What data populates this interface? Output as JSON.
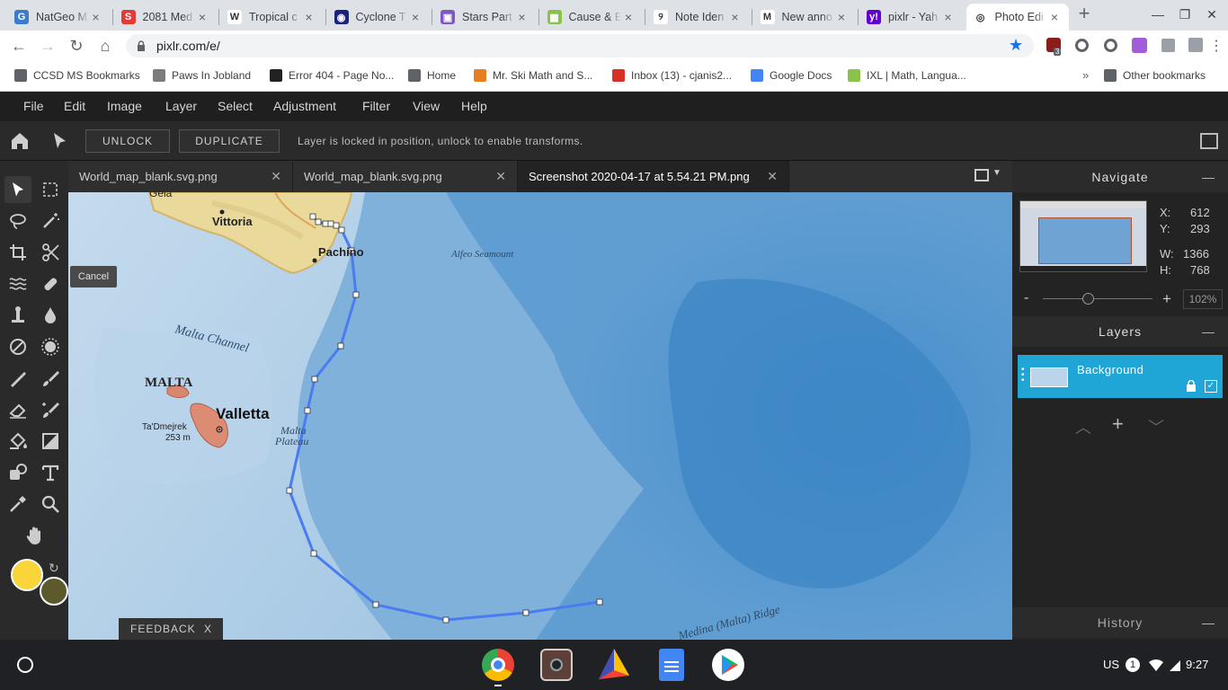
{
  "browser": {
    "tabs": [
      {
        "label": "NatGeo M",
        "color": "#3d7cc9",
        "glyph": "G"
      },
      {
        "label": "2081 Med",
        "color": "#e53935",
        "glyph": "S"
      },
      {
        "label": "Tropical c",
        "color": "#ffffff",
        "glyph": "W"
      },
      {
        "label": "Cyclone T",
        "color": "#1a237e",
        "glyph": "◉"
      },
      {
        "label": "Stars Part",
        "color": "#7e57c2",
        "glyph": "▣"
      },
      {
        "label": "Cause & E",
        "color": "#8bc34a",
        "glyph": "▦"
      },
      {
        "label": "Note Iden",
        "color": "#ffffff",
        "glyph": "୨"
      },
      {
        "label": "New anno",
        "color": "#ffffff",
        "glyph": "M"
      },
      {
        "label": "pixlr - Yah",
        "color": "#6001d2",
        "glyph": "y!"
      },
      {
        "label": "Photo Edi",
        "color": "#ffffff",
        "glyph": "◎"
      }
    ],
    "url": "pixlr.com/e/",
    "bookmarks": [
      "CCSD MS Bookmarks",
      "Paws In Jobland",
      "Error 404 - Page No...",
      "Home",
      "Mr. Ski Math and S...",
      "Inbox (13) - cjanis2...",
      "Google Docs",
      "IXL | Math, Langua..."
    ],
    "other_bookmarks": "Other bookmarks",
    "extension_badge": "3",
    "bookmark_more": "»"
  },
  "pixlr": {
    "menu": [
      "File",
      "Edit",
      "Image",
      "Layer",
      "Select",
      "Adjustment",
      "Filter",
      "View",
      "Help"
    ],
    "unlock_label": "UNLOCK",
    "duplicate_label": "DUPLICATE",
    "hint": "Layer is locked in position, unlock to enable transforms.",
    "doc_tabs": [
      "World_map_blank.svg.png",
      "World_map_blank.svg.png",
      "Screenshot 2020-04-17 at 5.54.21 PM.png"
    ],
    "cancel_label": "Cancel",
    "feedback_label": "FEEDBACK",
    "feedback_close": "X",
    "navigate": {
      "title": "Navigate",
      "x_label": "X:",
      "x": "612",
      "y_label": "Y:",
      "y": "293",
      "w_label": "W:",
      "w": "1366",
      "h_label": "H:",
      "h": "768",
      "zoom": "102%",
      "minus": "-",
      "plus": "+"
    },
    "layers": {
      "title": "Layers",
      "items": [
        "Background"
      ]
    },
    "history_title": "History",
    "colors": {
      "primary": "#f9d53a",
      "secondary": "#5c5a2a"
    }
  },
  "map_labels": {
    "gela": "Gela",
    "vittoria": "Vittoria",
    "pachino": "Pachino",
    "alfeo": "Alfeo Seamount",
    "malta_channel": "Malta Channel",
    "malta": "MALTA",
    "valletta": "Valletta",
    "tadmejrek": "Ta'Dmejrek",
    "elevation": "253 m",
    "plateau1": "Malta",
    "plateau2": "Plateau",
    "ridge": "Medina (Malta) Ridge"
  },
  "taskbar": {
    "locale": "US",
    "notif": "1",
    "time": "9:27"
  }
}
